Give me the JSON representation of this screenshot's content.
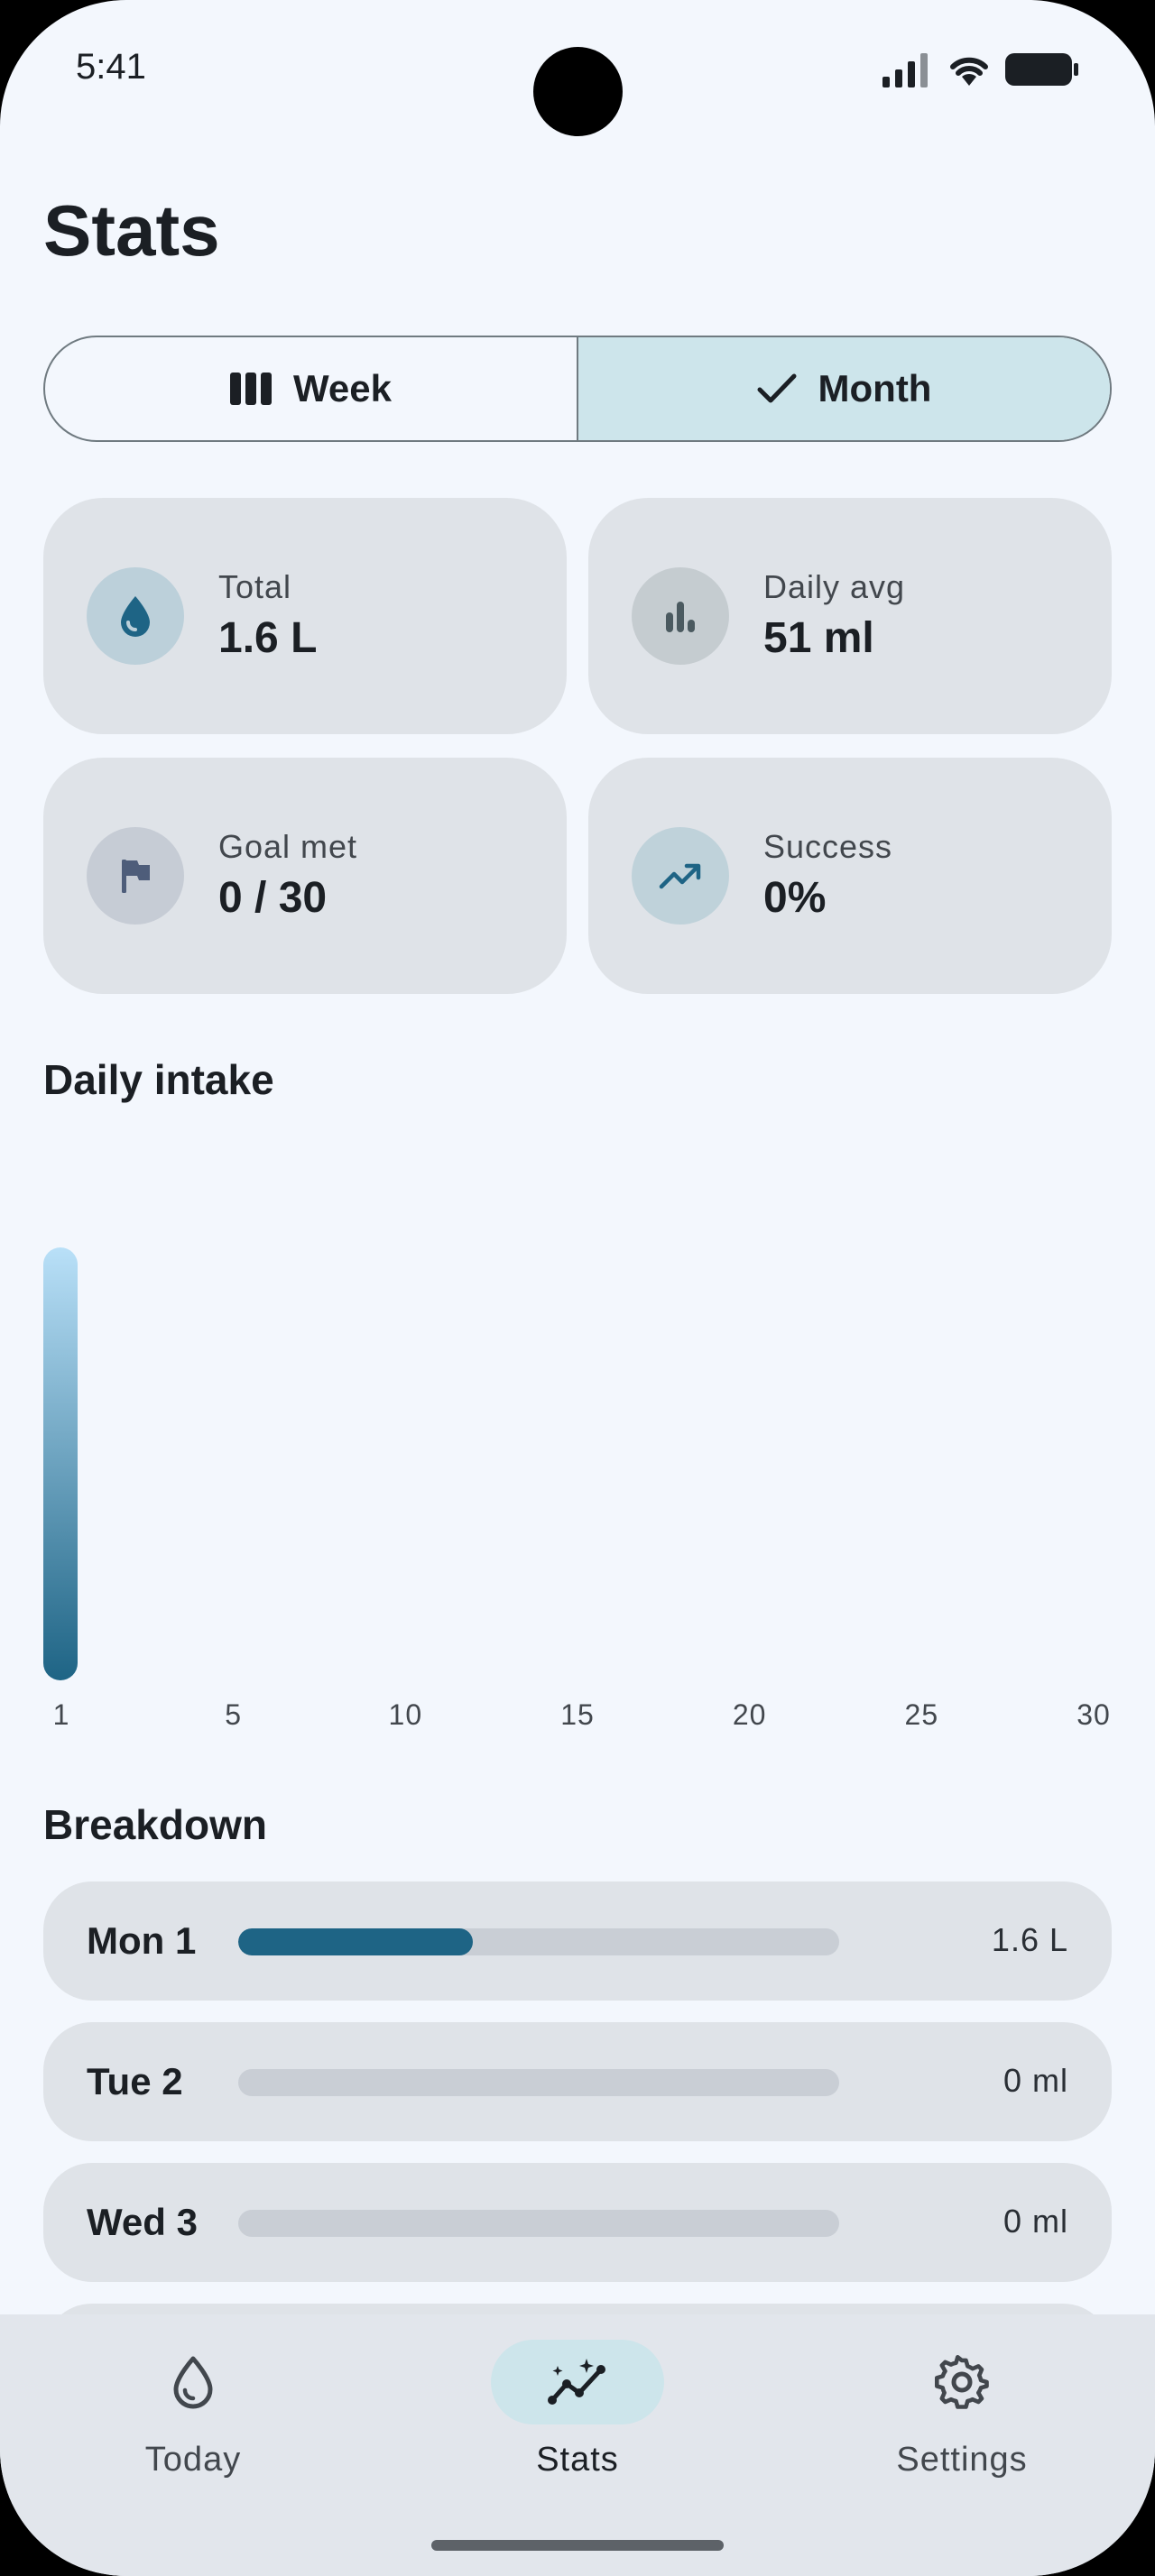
{
  "status_bar": {
    "time": "5:41"
  },
  "page": {
    "title": "Stats"
  },
  "period_toggle": {
    "week_label": "Week",
    "month_label": "Month",
    "selected": "Month"
  },
  "stats": {
    "total": {
      "label": "Total",
      "value": "1.6 L",
      "icon": "water-drop-icon",
      "badge_color": "#bcd0da",
      "icon_color": "#1e6485"
    },
    "daily_avg": {
      "label": "Daily avg",
      "value": "51 ml",
      "icon": "bar-chart-icon",
      "badge_color": "#c5ccd0",
      "icon_color": "#4b5a60"
    },
    "goal_met": {
      "label": "Goal met",
      "value": "0 / 30",
      "icon": "flag-icon",
      "badge_color": "#c6ccd5",
      "icon_color": "#4e5d7a"
    },
    "success": {
      "label": "Success",
      "value": "0%",
      "icon": "trending-up-icon",
      "badge_color": "#bfd2da",
      "icon_color": "#1e6485"
    }
  },
  "daily_intake": {
    "title": "Daily intake",
    "chart_data": {
      "type": "bar",
      "x_ticks": [
        "1",
        "5",
        "10",
        "15",
        "20",
        "25",
        "30"
      ],
      "days": [
        1,
        2,
        3,
        4,
        5,
        6,
        7,
        8,
        9,
        10,
        11,
        12,
        13,
        14,
        15,
        16,
        17,
        18,
        19,
        20,
        21,
        22,
        23,
        24,
        25,
        26,
        27,
        28,
        29,
        30
      ],
      "values": [
        1.6,
        0,
        0,
        0,
        0,
        0,
        0,
        0,
        0,
        0,
        0,
        0,
        0,
        0,
        0,
        0,
        0,
        0,
        0,
        0,
        0,
        0,
        0,
        0,
        0,
        0,
        0,
        0,
        0,
        0
      ],
      "unit": "L",
      "bar_gradient": [
        "#b9e0f8",
        "#1e6485"
      ]
    }
  },
  "breakdown": {
    "title": "Breakdown",
    "max": 4.0,
    "rows": [
      {
        "day": "Mon 1",
        "amount": "1.6 L",
        "progress": 0.39
      },
      {
        "day": "Tue 2",
        "amount": "0 ml",
        "progress": 0
      },
      {
        "day": "Wed 3",
        "amount": "0 ml",
        "progress": 0
      }
    ]
  },
  "bottom_nav": {
    "items": [
      {
        "label": "Today",
        "icon": "water-drop-outline-icon"
      },
      {
        "label": "Stats",
        "icon": "sparkle-chart-icon",
        "active": true
      },
      {
        "label": "Settings",
        "icon": "gear-icon"
      }
    ]
  }
}
